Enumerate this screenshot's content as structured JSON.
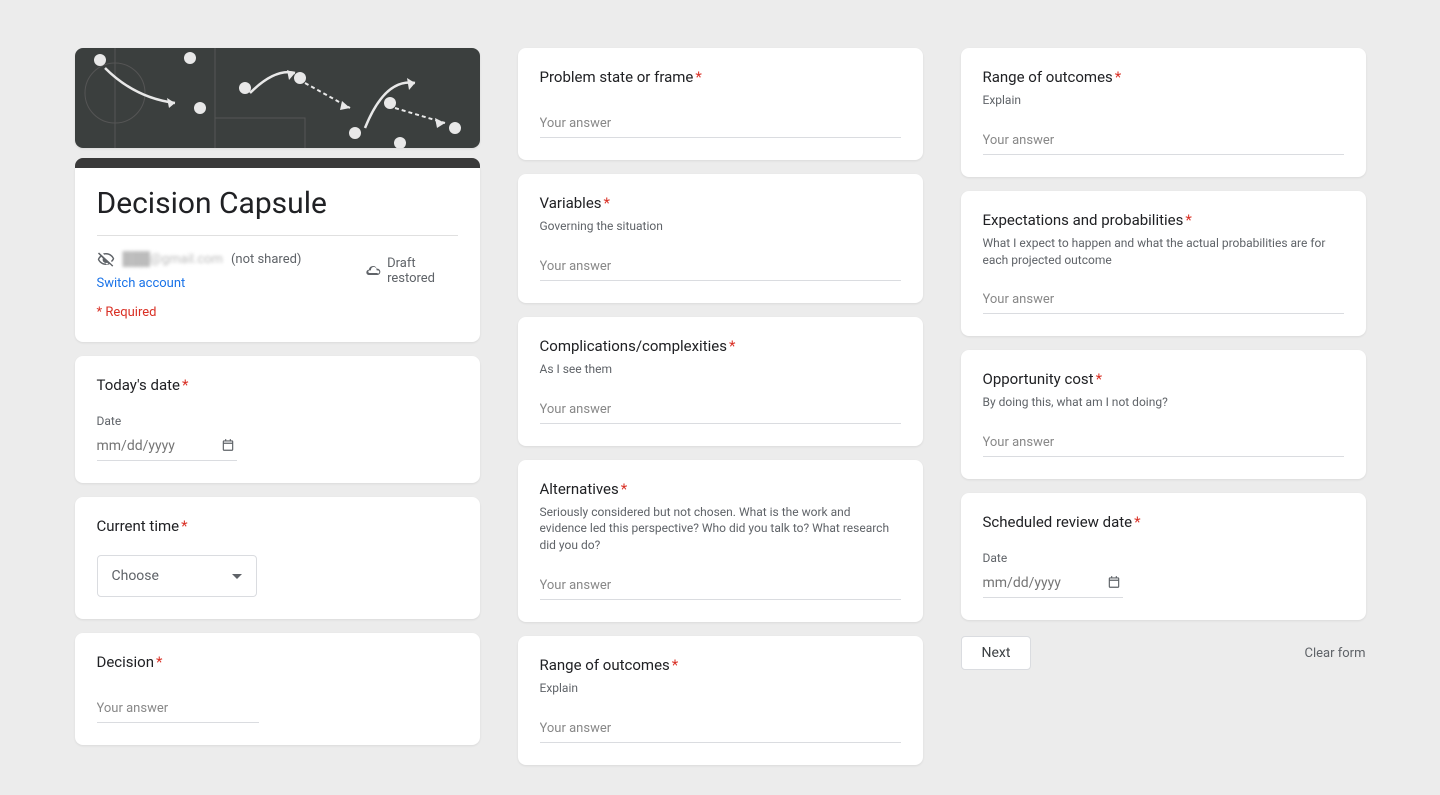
{
  "form": {
    "title": "Decision Capsule",
    "email_blur": "███@gmail.com",
    "not_shared": "(not shared)",
    "switch_account": "Switch account",
    "draft_restored": "Draft restored",
    "required_note": "* Required"
  },
  "q": {
    "todays_date": {
      "title": "Today's date",
      "date_label": "Date",
      "placeholder": "mm/dd/yyyy"
    },
    "current_time": {
      "title": "Current time",
      "choose": "Choose"
    },
    "decision": {
      "title": "Decision",
      "placeholder": "Your answer"
    },
    "problem_state": {
      "title": "Problem state or frame",
      "placeholder": "Your answer"
    },
    "variables": {
      "title": "Variables",
      "sub": "Governing the situation",
      "placeholder": "Your answer"
    },
    "complications": {
      "title": "Complications/complexities",
      "sub": "As I see them",
      "placeholder": "Your answer"
    },
    "alternatives": {
      "title": "Alternatives",
      "sub": "Seriously considered but not chosen. What is the work and evidence led this perspective? Who did you talk to? What research did you do?",
      "placeholder": "Your answer"
    },
    "range1": {
      "title": "Range of outcomes",
      "sub": "Explain",
      "placeholder": "Your answer"
    },
    "range2": {
      "title": "Range of outcomes",
      "sub": "Explain",
      "placeholder": "Your answer"
    },
    "expectations": {
      "title": "Expectations and probabilities",
      "sub": "What I expect to happen and what the actual probabilities are for each projected outcome",
      "placeholder": "Your answer"
    },
    "opportunity": {
      "title": "Opportunity cost",
      "sub": "By doing this, what am I not doing?",
      "placeholder": "Your answer"
    },
    "review_date": {
      "title": "Scheduled review date",
      "date_label": "Date",
      "placeholder": "mm/dd/yyyy"
    }
  },
  "footer": {
    "next": "Next",
    "clear": "Clear form"
  }
}
